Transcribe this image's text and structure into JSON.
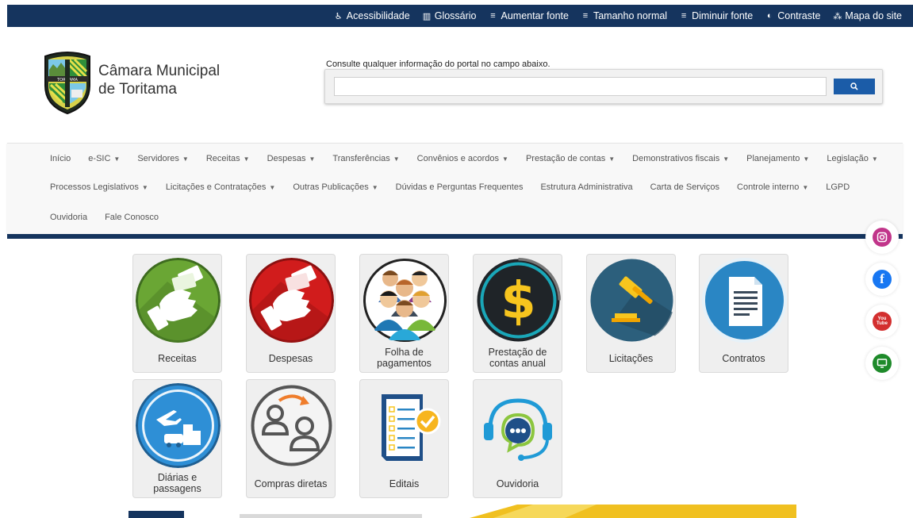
{
  "topbar": {
    "items": [
      {
        "icon": "accessibility-icon",
        "label": "Acessibilidade"
      },
      {
        "icon": "book-icon",
        "label": "Glossário"
      },
      {
        "icon": "font-increase-icon",
        "label": "Aumentar fonte"
      },
      {
        "icon": "font-normal-icon",
        "label": "Tamanho normal"
      },
      {
        "icon": "font-decrease-icon",
        "label": "Diminuir fonte"
      },
      {
        "icon": "contrast-icon",
        "label": "Contraste"
      },
      {
        "icon": "sitemap-icon",
        "label": "Mapa do site"
      }
    ]
  },
  "header": {
    "site_name_line1": "Câmara Municipal",
    "site_name_line2": "de Toritama",
    "logo_text": "TORITAMA",
    "search_hint": "Consulte qualquer informação do portal no campo abaixo.",
    "search_value": "",
    "search_icon": "search-icon"
  },
  "nav": {
    "row1": [
      {
        "label": "Início",
        "dropdown": false
      },
      {
        "label": "e-SIC",
        "dropdown": true
      },
      {
        "label": "Servidores",
        "dropdown": true
      },
      {
        "label": "Receitas",
        "dropdown": true
      },
      {
        "label": "Despesas",
        "dropdown": true
      },
      {
        "label": "Transferências",
        "dropdown": true
      },
      {
        "label": "Convênios e acordos",
        "dropdown": true
      },
      {
        "label": "Prestação de contas",
        "dropdown": true
      },
      {
        "label": "Demonstrativos fiscais",
        "dropdown": true
      },
      {
        "label": "Planejamento",
        "dropdown": true
      },
      {
        "label": "Legislação",
        "dropdown": true
      }
    ],
    "row2": [
      {
        "label": "Processos Legislativos",
        "dropdown": true
      },
      {
        "label": "Licitações e Contratações",
        "dropdown": true
      },
      {
        "label": "Outras Publicações",
        "dropdown": true
      },
      {
        "label": "Dúvidas e Perguntas Frequentes",
        "dropdown": false
      },
      {
        "label": "Estrutura Administrativa",
        "dropdown": false
      },
      {
        "label": "Carta de Serviços",
        "dropdown": false
      },
      {
        "label": "Controle interno",
        "dropdown": true
      },
      {
        "label": "LGPD",
        "dropdown": false
      }
    ],
    "row3": [
      {
        "label": "Ouvidoria",
        "dropdown": false
      },
      {
        "label": "Fale Conosco",
        "dropdown": false
      }
    ]
  },
  "social": [
    {
      "name": "instagram-icon",
      "color": "#c1358a"
    },
    {
      "name": "facebook-icon",
      "color": "#1877f2"
    },
    {
      "name": "youtube-icon",
      "color": "#d32f2f"
    },
    {
      "name": "monitor-icon",
      "color": "#1e8a2a"
    }
  ],
  "youtube_text": {
    "top": "You",
    "bottom": "Tube"
  },
  "tiles": [
    {
      "label": "Receitas"
    },
    {
      "label": "Despesas"
    },
    {
      "label": "Folha de\npagamentos"
    },
    {
      "label": "Prestação de\ncontas anual"
    },
    {
      "label": "Licitações"
    },
    {
      "label": "Contratos"
    },
    {
      "label": "Diárias e\npassagens"
    },
    {
      "label": "Compras diretas"
    },
    {
      "label": "Editais"
    },
    {
      "label": "Ouvidoria"
    }
  ],
  "colors": {
    "topbar": "#15345e",
    "search_button": "#1b5ca8",
    "receitas": "#6aa634",
    "despesas": "#d11c1c",
    "licitacoes": "#2c5f7c",
    "contratos": "#2a86c4",
    "diarias": "#2e8fd6"
  }
}
